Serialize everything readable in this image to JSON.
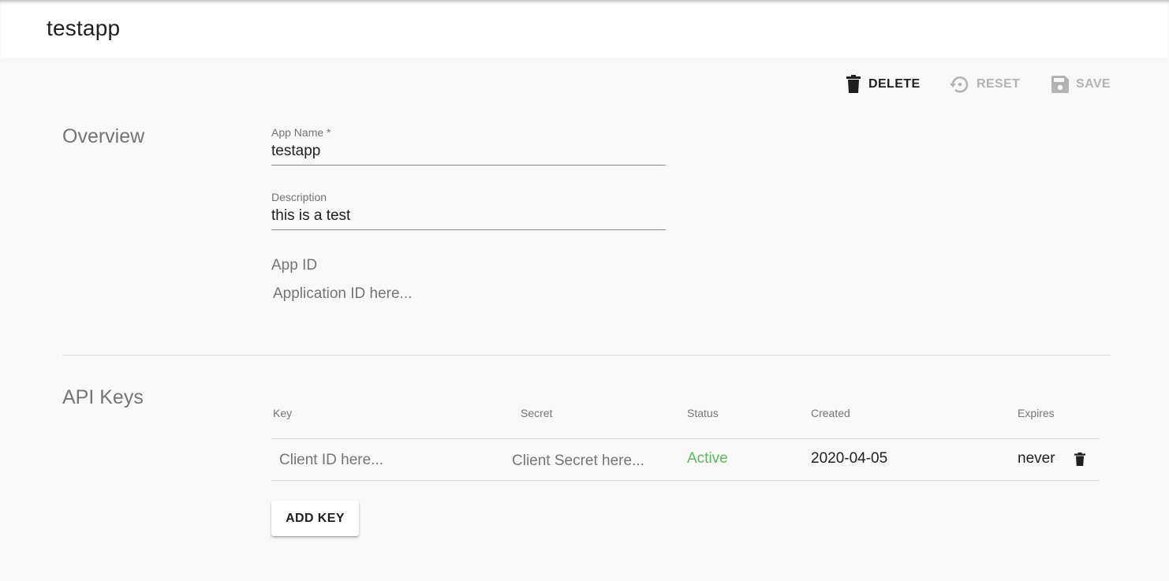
{
  "header": {
    "title": "testapp"
  },
  "toolbar": {
    "delete_label": "DELETE",
    "reset_label": "RESET",
    "save_label": "SAVE"
  },
  "overview": {
    "title": "Overview",
    "app_name": {
      "label": "App Name *",
      "value": "testapp"
    },
    "description": {
      "label": "Description",
      "value": "this is a test"
    },
    "app_id": {
      "label": "App ID",
      "value": "Application ID here..."
    }
  },
  "api_keys": {
    "title": "API Keys",
    "columns": [
      "Key",
      "Secret",
      "Status",
      "Created",
      "Expires"
    ],
    "rows": [
      {
        "key": "Client ID here...",
        "secret": "Client Secret here...",
        "status": "Active",
        "created": "2020-04-05",
        "expires": "never"
      }
    ],
    "add_key_label": "ADD KEY"
  },
  "colors": {
    "status_active": "#5cb85c",
    "disabled_text": "#b3b3b3",
    "muted_text": "#757575"
  },
  "icons": {
    "delete": "trash-icon",
    "reset": "restore-icon",
    "save": "floppy-disk-icon",
    "row_delete": "trash-icon"
  }
}
